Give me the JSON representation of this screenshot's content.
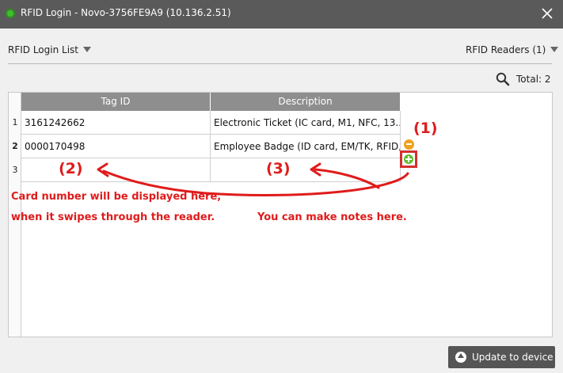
{
  "window": {
    "title": "RFID Login - Novo-3756FE9A9 (10.136.2.51)",
    "close_icon": "close-icon",
    "app_icon": "app-status-icon"
  },
  "toolbar": {
    "list_dropdown": "RFID Login List",
    "readers_dropdown": "RFID Readers (1)"
  },
  "summary": {
    "search_icon": "search-icon",
    "total_label": "Total: 2"
  },
  "table": {
    "headers": [
      "Tag ID",
      "Description"
    ],
    "rows": [
      {
        "num": "1",
        "tag_id": "3161242662",
        "description": "Electronic Ticket (IC card, M1, NFC, 13...."
      },
      {
        "num": "2",
        "tag_id": "0000170498",
        "description": "Employee Badge (ID card, EM/TK, RFID,...."
      },
      {
        "num": "3",
        "tag_id": "",
        "description": ""
      }
    ]
  },
  "row_actions": {
    "remove_icon": "remove-row-icon",
    "add_icon": "add-row-icon"
  },
  "annotations": {
    "label_1": "(1)",
    "label_2": "(2)",
    "label_3": "(3)",
    "card_note_line1": "Card number will be displayed here,",
    "card_note_line2": "when it swipes through the reader.",
    "notes_hint": "You can make notes here.",
    "color": "#e01b1b"
  },
  "footer": {
    "update_button": "Update to device",
    "update_icon": "upload-icon"
  }
}
